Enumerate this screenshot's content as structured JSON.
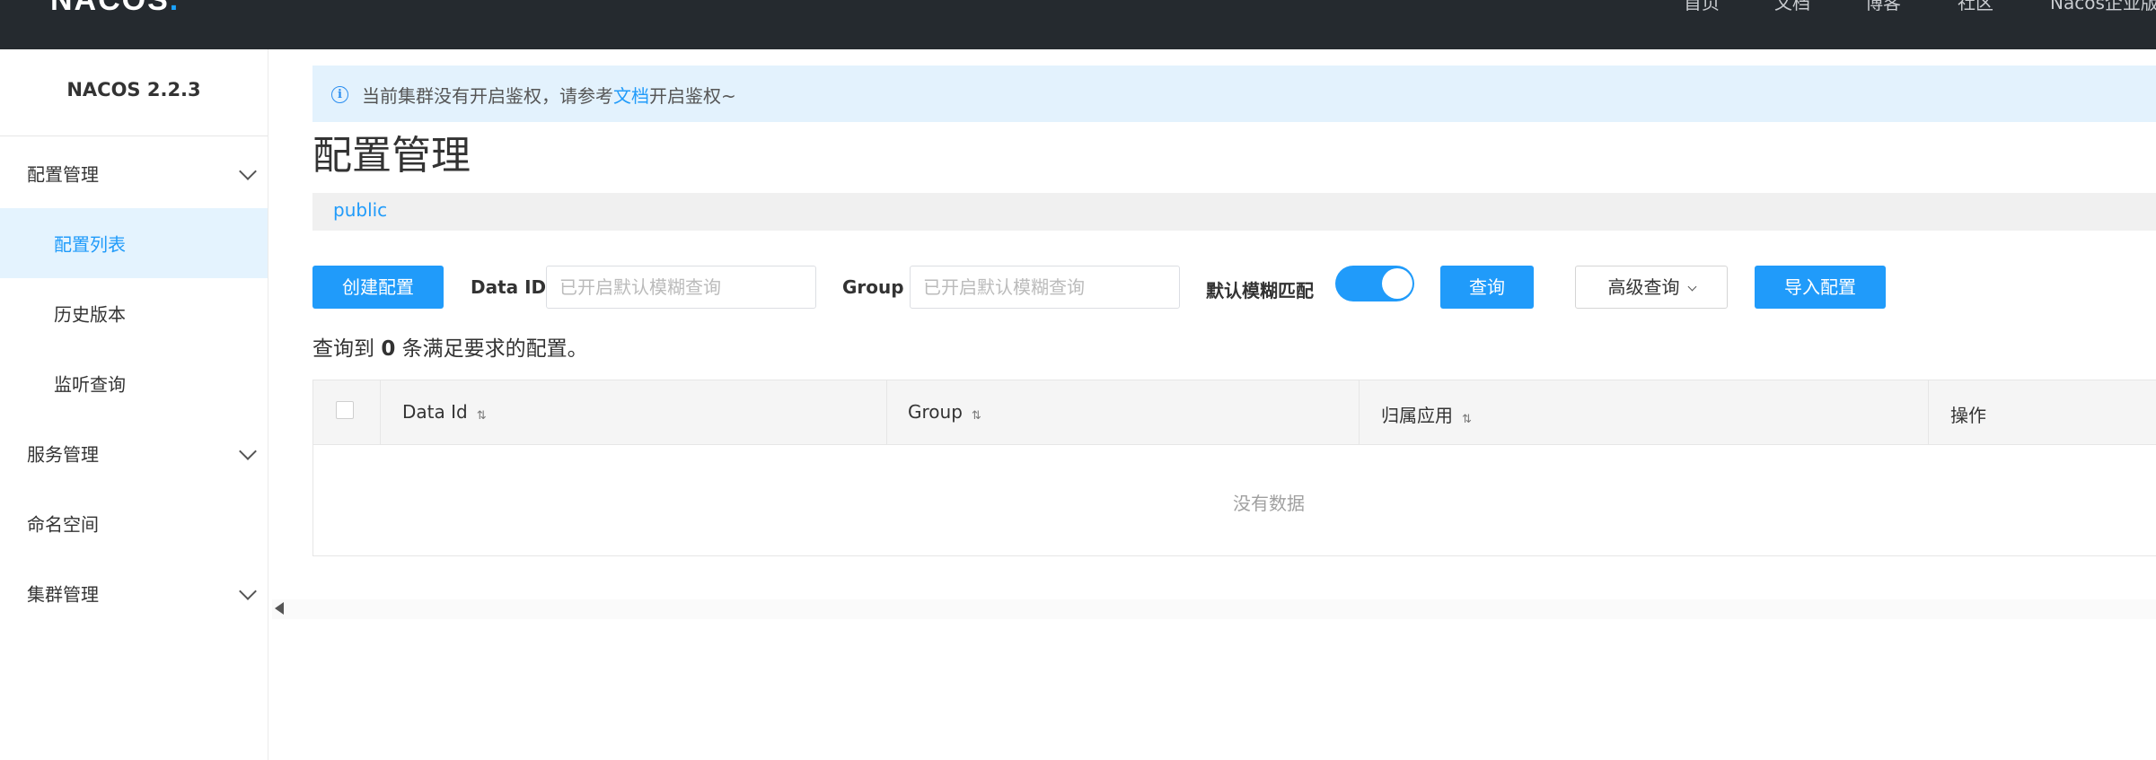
{
  "header": {
    "logo": "NACOS.",
    "nav": [
      "首页",
      "文档",
      "博客",
      "社区",
      "Nacos企业版"
    ]
  },
  "sidebar": {
    "version": "NACOS 2.2.3",
    "items": [
      {
        "label": "配置管理",
        "type": "group",
        "expanded": true
      },
      {
        "label": "配置列表",
        "type": "sub",
        "active": true
      },
      {
        "label": "历史版本",
        "type": "sub"
      },
      {
        "label": "监听查询",
        "type": "sub"
      },
      {
        "label": "服务管理",
        "type": "group"
      },
      {
        "label": "命名空间",
        "type": "item"
      },
      {
        "label": "集群管理",
        "type": "group"
      }
    ]
  },
  "alert": {
    "prefix": "当前集群没有开启鉴权，请参考",
    "link": "文档",
    "suffix": "开启鉴权~"
  },
  "page": {
    "title": "配置管理",
    "namespace": "public"
  },
  "toolbar": {
    "create_label": "创建配置",
    "data_id_label": "Data ID",
    "data_id_placeholder": "已开启默认模糊查询",
    "group_label": "Group",
    "group_placeholder": "已开启默认模糊查询",
    "fuzzy_label": "默认模糊匹配",
    "fuzzy_on": true,
    "query_label": "查询",
    "advanced_label": "高级查询",
    "import_label": "导入配置"
  },
  "result": {
    "prefix": "查询到 ",
    "count": "0",
    "suffix": " 条满足要求的配置。"
  },
  "table": {
    "columns": [
      "Data Id",
      "Group",
      "归属应用",
      "操作"
    ],
    "empty_text": "没有数据"
  },
  "colors": {
    "primary": "#209bfa",
    "header_bg": "#252a2f",
    "alert_bg": "#e3f2fd",
    "active_bg": "#e4f3fe"
  }
}
